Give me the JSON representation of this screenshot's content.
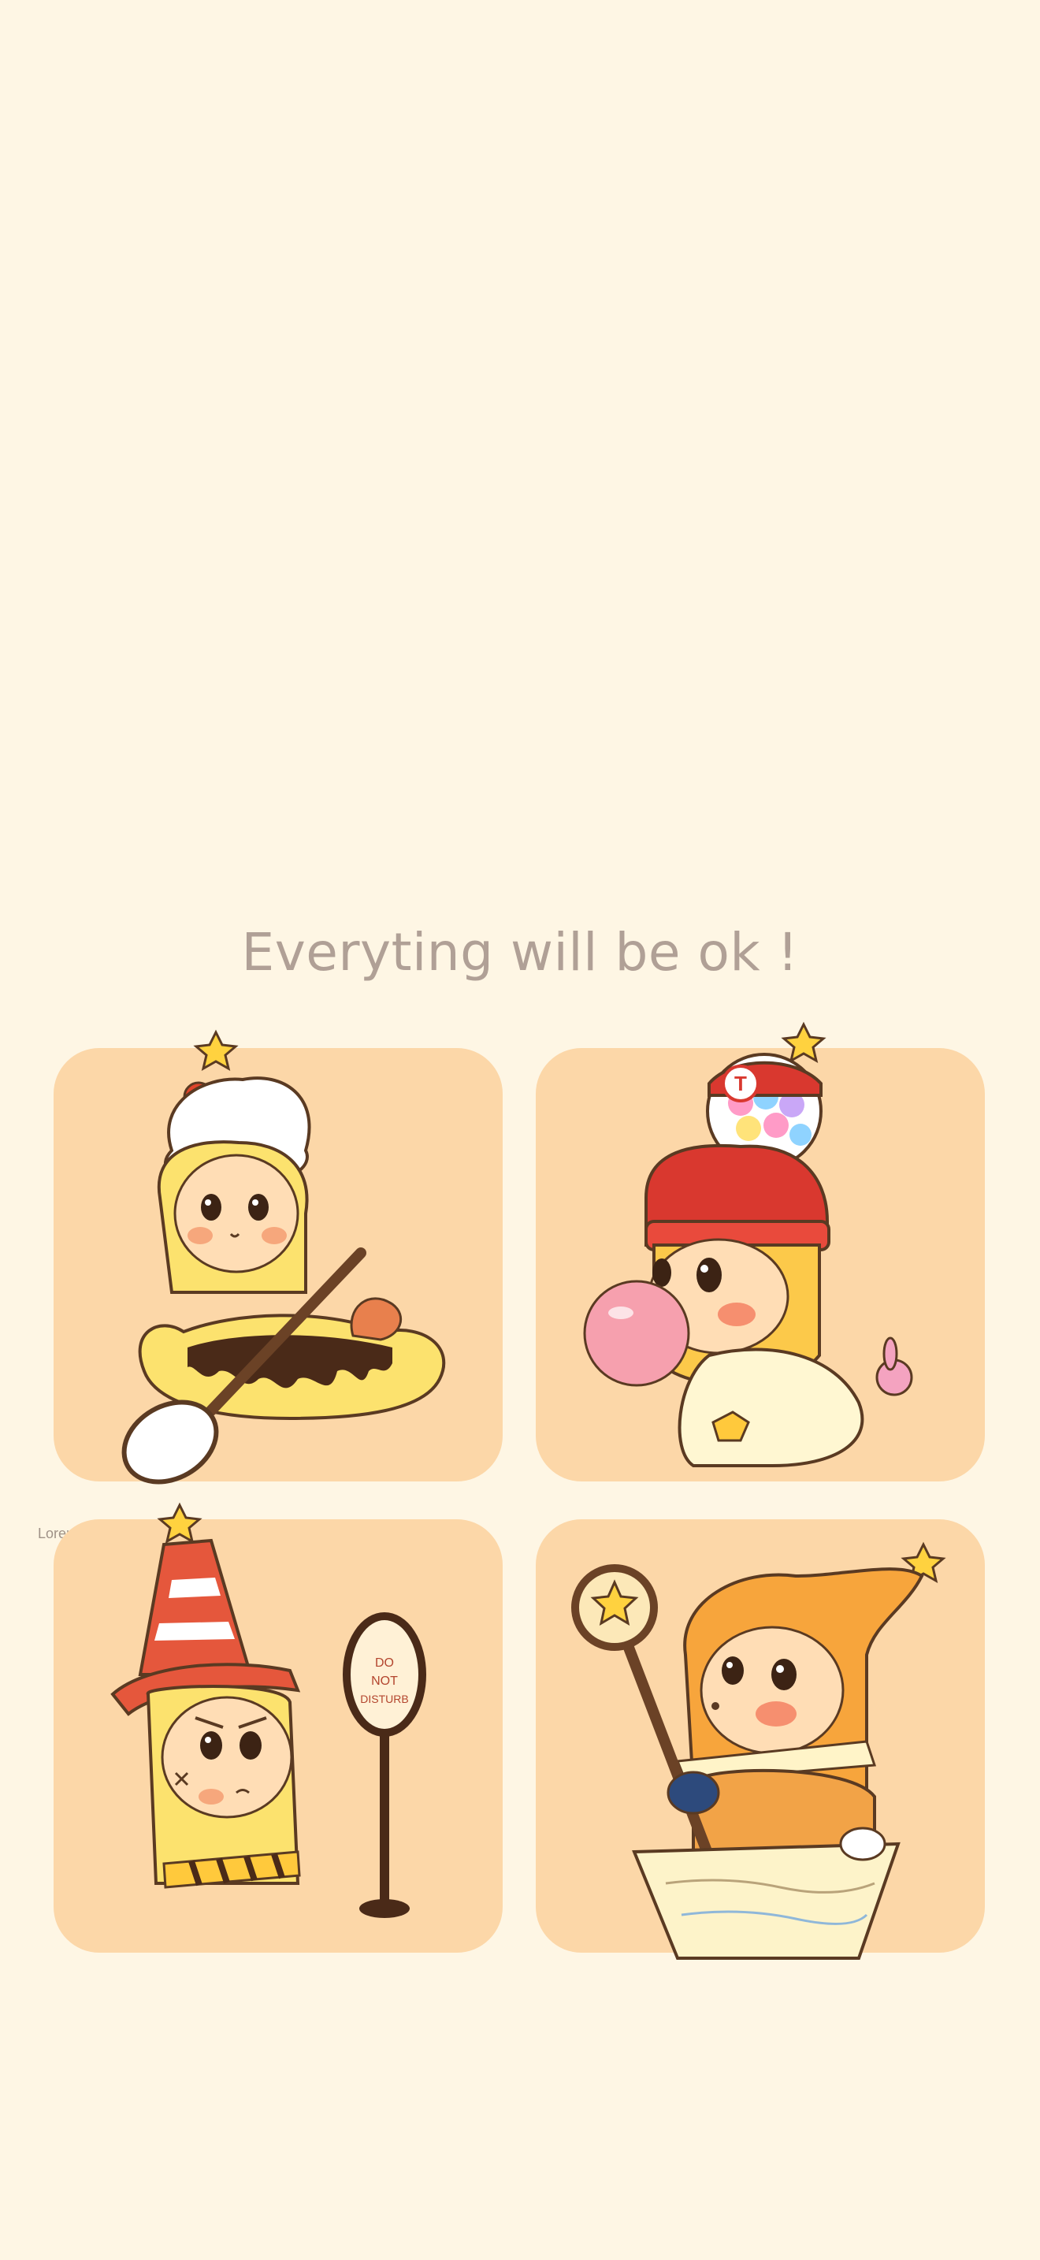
{
  "headline": "Everyting will be ok !",
  "caption": "Lorem ipsum",
  "sign_text": {
    "line1": "DO",
    "line2": "NOT",
    "line3": "DISTURB"
  },
  "hat_badge": "T",
  "colors": {
    "background": "#FEF6E4",
    "card": "#FCD7A8",
    "headline_text": "#B0A096"
  }
}
